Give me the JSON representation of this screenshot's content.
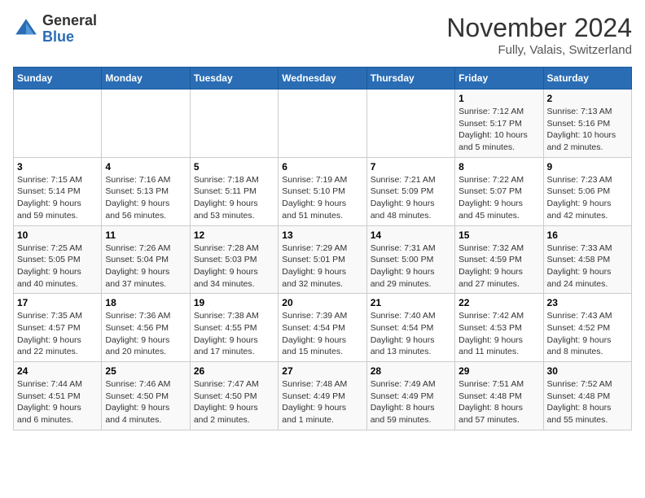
{
  "header": {
    "logo_general": "General",
    "logo_blue": "Blue",
    "month": "November 2024",
    "location": "Fully, Valais, Switzerland"
  },
  "weekdays": [
    "Sunday",
    "Monday",
    "Tuesday",
    "Wednesday",
    "Thursday",
    "Friday",
    "Saturday"
  ],
  "weeks": [
    [
      {
        "day": "",
        "info": ""
      },
      {
        "day": "",
        "info": ""
      },
      {
        "day": "",
        "info": ""
      },
      {
        "day": "",
        "info": ""
      },
      {
        "day": "",
        "info": ""
      },
      {
        "day": "1",
        "info": "Sunrise: 7:12 AM\nSunset: 5:17 PM\nDaylight: 10 hours\nand 5 minutes."
      },
      {
        "day": "2",
        "info": "Sunrise: 7:13 AM\nSunset: 5:16 PM\nDaylight: 10 hours\nand 2 minutes."
      }
    ],
    [
      {
        "day": "3",
        "info": "Sunrise: 7:15 AM\nSunset: 5:14 PM\nDaylight: 9 hours\nand 59 minutes."
      },
      {
        "day": "4",
        "info": "Sunrise: 7:16 AM\nSunset: 5:13 PM\nDaylight: 9 hours\nand 56 minutes."
      },
      {
        "day": "5",
        "info": "Sunrise: 7:18 AM\nSunset: 5:11 PM\nDaylight: 9 hours\nand 53 minutes."
      },
      {
        "day": "6",
        "info": "Sunrise: 7:19 AM\nSunset: 5:10 PM\nDaylight: 9 hours\nand 51 minutes."
      },
      {
        "day": "7",
        "info": "Sunrise: 7:21 AM\nSunset: 5:09 PM\nDaylight: 9 hours\nand 48 minutes."
      },
      {
        "day": "8",
        "info": "Sunrise: 7:22 AM\nSunset: 5:07 PM\nDaylight: 9 hours\nand 45 minutes."
      },
      {
        "day": "9",
        "info": "Sunrise: 7:23 AM\nSunset: 5:06 PM\nDaylight: 9 hours\nand 42 minutes."
      }
    ],
    [
      {
        "day": "10",
        "info": "Sunrise: 7:25 AM\nSunset: 5:05 PM\nDaylight: 9 hours\nand 40 minutes."
      },
      {
        "day": "11",
        "info": "Sunrise: 7:26 AM\nSunset: 5:04 PM\nDaylight: 9 hours\nand 37 minutes."
      },
      {
        "day": "12",
        "info": "Sunrise: 7:28 AM\nSunset: 5:03 PM\nDaylight: 9 hours\nand 34 minutes."
      },
      {
        "day": "13",
        "info": "Sunrise: 7:29 AM\nSunset: 5:01 PM\nDaylight: 9 hours\nand 32 minutes."
      },
      {
        "day": "14",
        "info": "Sunrise: 7:31 AM\nSunset: 5:00 PM\nDaylight: 9 hours\nand 29 minutes."
      },
      {
        "day": "15",
        "info": "Sunrise: 7:32 AM\nSunset: 4:59 PM\nDaylight: 9 hours\nand 27 minutes."
      },
      {
        "day": "16",
        "info": "Sunrise: 7:33 AM\nSunset: 4:58 PM\nDaylight: 9 hours\nand 24 minutes."
      }
    ],
    [
      {
        "day": "17",
        "info": "Sunrise: 7:35 AM\nSunset: 4:57 PM\nDaylight: 9 hours\nand 22 minutes."
      },
      {
        "day": "18",
        "info": "Sunrise: 7:36 AM\nSunset: 4:56 PM\nDaylight: 9 hours\nand 20 minutes."
      },
      {
        "day": "19",
        "info": "Sunrise: 7:38 AM\nSunset: 4:55 PM\nDaylight: 9 hours\nand 17 minutes."
      },
      {
        "day": "20",
        "info": "Sunrise: 7:39 AM\nSunset: 4:54 PM\nDaylight: 9 hours\nand 15 minutes."
      },
      {
        "day": "21",
        "info": "Sunrise: 7:40 AM\nSunset: 4:54 PM\nDaylight: 9 hours\nand 13 minutes."
      },
      {
        "day": "22",
        "info": "Sunrise: 7:42 AM\nSunset: 4:53 PM\nDaylight: 9 hours\nand 11 minutes."
      },
      {
        "day": "23",
        "info": "Sunrise: 7:43 AM\nSunset: 4:52 PM\nDaylight: 9 hours\nand 8 minutes."
      }
    ],
    [
      {
        "day": "24",
        "info": "Sunrise: 7:44 AM\nSunset: 4:51 PM\nDaylight: 9 hours\nand 6 minutes."
      },
      {
        "day": "25",
        "info": "Sunrise: 7:46 AM\nSunset: 4:50 PM\nDaylight: 9 hours\nand 4 minutes."
      },
      {
        "day": "26",
        "info": "Sunrise: 7:47 AM\nSunset: 4:50 PM\nDaylight: 9 hours\nand 2 minutes."
      },
      {
        "day": "27",
        "info": "Sunrise: 7:48 AM\nSunset: 4:49 PM\nDaylight: 9 hours\nand 1 minute."
      },
      {
        "day": "28",
        "info": "Sunrise: 7:49 AM\nSunset: 4:49 PM\nDaylight: 8 hours\nand 59 minutes."
      },
      {
        "day": "29",
        "info": "Sunrise: 7:51 AM\nSunset: 4:48 PM\nDaylight: 8 hours\nand 57 minutes."
      },
      {
        "day": "30",
        "info": "Sunrise: 7:52 AM\nSunset: 4:48 PM\nDaylight: 8 hours\nand 55 minutes."
      }
    ]
  ]
}
